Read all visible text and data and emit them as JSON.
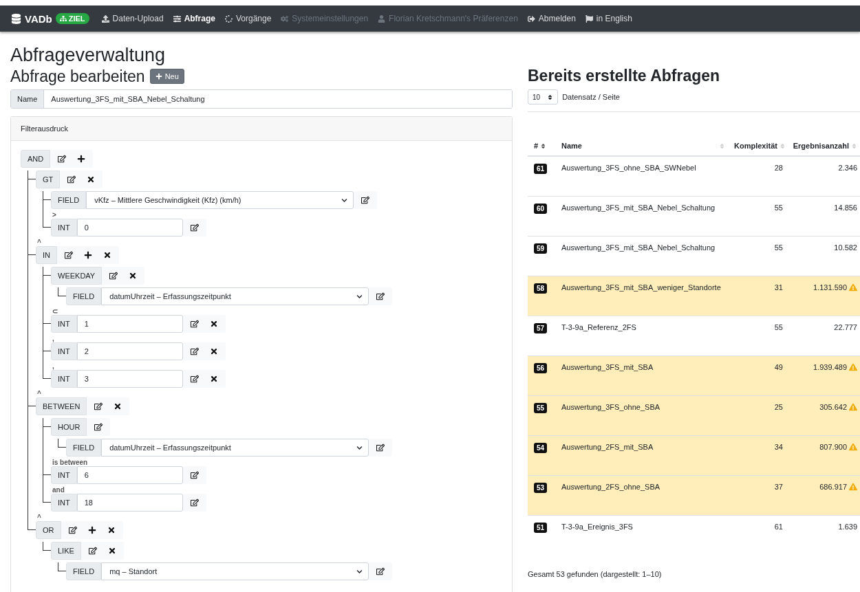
{
  "navbar": {
    "brand": "VADb",
    "badge": "ZIEL",
    "items": [
      {
        "label": "Daten-Upload",
        "selected": false,
        "disabled": false
      },
      {
        "label": "Abfrage",
        "selected": true,
        "disabled": false
      },
      {
        "label": "Vorgänge",
        "selected": false,
        "disabled": false
      },
      {
        "label": "Systemeinstellungen",
        "selected": false,
        "disabled": true
      },
      {
        "label": "Florian Kretschmann's Präferenzen",
        "selected": false,
        "disabled": true
      },
      {
        "label": "Abmelden",
        "selected": false,
        "disabled": false
      },
      {
        "label": "in English",
        "selected": false,
        "disabled": false
      }
    ]
  },
  "page_title": "Abfrageverwaltung",
  "editor": {
    "title": "Abfrage bearbeiten",
    "new_button": "Neu",
    "name_label": "Name",
    "name_value": "Auswertung_3FS_mit_SBA_Nebel_Schaltung",
    "filter_title": "Filterausdruck",
    "tree": {
      "kind": "op",
      "label": "AND",
      "editable": true,
      "addable": true,
      "removable": false,
      "children": [
        {
          "kind": "op",
          "label": "GT",
          "editable": true,
          "addable": false,
          "removable": true,
          "children": [
            {
              "kind": "field",
              "label": "FIELD",
              "value": "vKfz – Mittlere Geschwindigkeit (Kfz) (km/h)",
              "editable": true,
              "addable": false,
              "removable": false
            },
            {
              "kind": "int",
              "prefix": ">",
              "label": "INT",
              "value": "0",
              "editable": true,
              "addable": false,
              "removable": false
            }
          ]
        },
        {
          "kind": "op",
          "prefix": "^",
          "label": "IN",
          "editable": true,
          "addable": true,
          "removable": true,
          "children": [
            {
              "kind": "op",
              "label": "WEEKDAY",
              "editable": true,
              "addable": false,
              "removable": true,
              "children": [
                {
                  "kind": "field",
                  "label": "FIELD",
                  "value": "datumUhrzeit – Erfassungszeitpunkt",
                  "editable": true,
                  "addable": false,
                  "removable": false
                }
              ]
            },
            {
              "kind": "int",
              "prefix": "⊂",
              "label": "INT",
              "value": "1",
              "editable": true,
              "addable": false,
              "removable": true
            },
            {
              "kind": "int",
              "prefix": ",",
              "label": "INT",
              "value": "2",
              "editable": true,
              "addable": false,
              "removable": true
            },
            {
              "kind": "int",
              "prefix": ",",
              "label": "INT",
              "value": "3",
              "editable": true,
              "addable": false,
              "removable": true
            }
          ]
        },
        {
          "kind": "op",
          "prefix": "^",
          "label": "BETWEEN",
          "editable": true,
          "addable": false,
          "removable": true,
          "children": [
            {
              "kind": "op",
              "label": "HOUR",
              "editable": true,
              "addable": false,
              "removable": false,
              "children": [
                {
                  "kind": "field",
                  "label": "FIELD",
                  "value": "datumUhrzeit – Erfassungszeitpunkt",
                  "editable": true,
                  "addable": false,
                  "removable": false
                }
              ]
            },
            {
              "kind": "int",
              "prefix": "is between",
              "label": "INT",
              "value": "6",
              "editable": true,
              "addable": false,
              "removable": false
            },
            {
              "kind": "int",
              "prefix": "and",
              "label": "INT",
              "value": "18",
              "editable": true,
              "addable": false,
              "removable": false
            }
          ]
        },
        {
          "kind": "op",
          "prefix": "^",
          "label": "OR",
          "editable": true,
          "addable": true,
          "removable": true,
          "children": [
            {
              "kind": "op",
              "label": "LIKE",
              "editable": true,
              "addable": false,
              "removable": true,
              "children": [
                {
                  "kind": "field",
                  "label": "FIELD",
                  "value": "mq – Standort",
                  "editable": true,
                  "addable": false,
                  "removable": false
                }
              ]
            }
          ]
        }
      ]
    }
  },
  "list": {
    "title": "Bereits erstellte Abfragen",
    "page_size": "10",
    "page_size_label": "Datensatz / Seite",
    "columns": [
      {
        "label": "#",
        "sorted": true
      },
      {
        "label": "Name",
        "sorted": false
      },
      {
        "label": "Komplexität",
        "sorted": false
      },
      {
        "label": "Ergebnisanzahl",
        "sorted": false
      }
    ],
    "rows": [
      {
        "id": "61",
        "name": "Auswertung_3FS_ohne_SBA_SWNebel",
        "complexity": "28",
        "results": "2.346",
        "warning": false
      },
      {
        "id": "60",
        "name": "Auswertung_3FS_mit_SBA_Nebel_Schaltung",
        "complexity": "55",
        "results": "14.856",
        "warning": false
      },
      {
        "id": "59",
        "name": "Auswertung_3FS_mit_SBA_Nebel_Schaltung",
        "complexity": "55",
        "results": "10.582",
        "warning": false
      },
      {
        "id": "58",
        "name": "Auswertung_3FS_mit_SBA_weniger_Standorte",
        "complexity": "31",
        "results": "1.131.590",
        "warning": true
      },
      {
        "id": "57",
        "name": "T-3-9a_Referenz_2FS",
        "complexity": "55",
        "results": "22.777",
        "warning": false
      },
      {
        "id": "56",
        "name": "Auswertung_3FS_mit_SBA",
        "complexity": "49",
        "results": "1.939.489",
        "warning": true
      },
      {
        "id": "55",
        "name": "Auswertung_3FS_ohne_SBA",
        "complexity": "25",
        "results": "305.642",
        "warning": true
      },
      {
        "id": "54",
        "name": "Auswertung_2FS_mit_SBA",
        "complexity": "34",
        "results": "807.900",
        "warning": true
      },
      {
        "id": "53",
        "name": "Auswertung_2FS_ohne_SBA",
        "complexity": "37",
        "results": "686.917",
        "warning": true
      },
      {
        "id": "51",
        "name": "T-3-9a_Ereignis_3FS",
        "complexity": "61",
        "results": "1.639",
        "warning": false
      }
    ],
    "footer": "Gesamt 53 gefunden (dargestellt: 1–10)"
  }
}
